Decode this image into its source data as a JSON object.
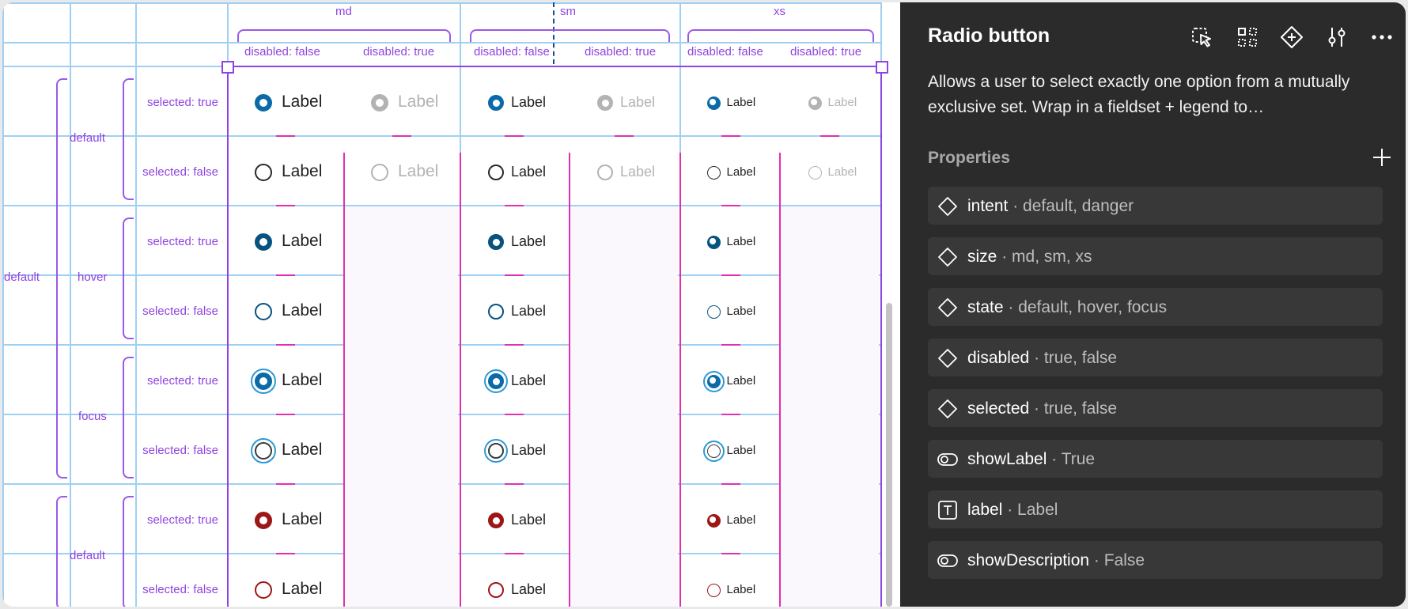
{
  "canvas": {
    "size_labels": [
      "md",
      "sm",
      "xs"
    ],
    "disabled_labels": [
      "disabled: false",
      "disabled: true",
      "disabled: false",
      "disabled: true",
      "disabled: false",
      "disabled: true"
    ],
    "group_intent": "default",
    "group_intent_2": "default",
    "states": [
      "default",
      "hover",
      "focus",
      "default"
    ],
    "selected_labels": [
      "selected: true",
      "selected: false",
      "selected: true",
      "selected: false",
      "selected: true",
      "selected: false",
      "selected: true",
      "selected: false"
    ],
    "radio_label": "Label",
    "colors": {
      "blue": "#0b6ba8",
      "blue_hover": "#075380",
      "focus_ring": "#2b9ad6",
      "danger": "#9d1717",
      "disabled": "#b3b3b3",
      "guide": "#9fd0f3",
      "purple": "#8f43e0",
      "magenta": "#e22fb1"
    }
  },
  "panel": {
    "title": "Radio button",
    "description": "Allows a user to select exactly one option from a mutually exclusive set. Wrap in a fieldset + legend to…",
    "properties_heading": "Properties",
    "icons": [
      "select-instance-icon",
      "variants-grid-icon",
      "component-diamond-icon",
      "adjust-sliders-icon",
      "more-icon",
      "add-icon"
    ],
    "properties": [
      {
        "name": "intent",
        "values": "default, danger",
        "icon": "variant-diamond-icon"
      },
      {
        "name": "size",
        "values": "md, sm, xs",
        "icon": "variant-diamond-icon"
      },
      {
        "name": "state",
        "values": "default, hover, focus",
        "icon": "variant-diamond-icon"
      },
      {
        "name": "disabled",
        "values": "true, false",
        "icon": "variant-diamond-icon"
      },
      {
        "name": "selected",
        "values": "true, false",
        "icon": "variant-diamond-icon"
      },
      {
        "name": "showLabel",
        "values": "True",
        "icon": "toggle-icon"
      },
      {
        "name": "label",
        "values": "Label",
        "icon": "text-icon"
      },
      {
        "name": "showDescription",
        "values": "False",
        "icon": "toggle-icon"
      }
    ]
  }
}
